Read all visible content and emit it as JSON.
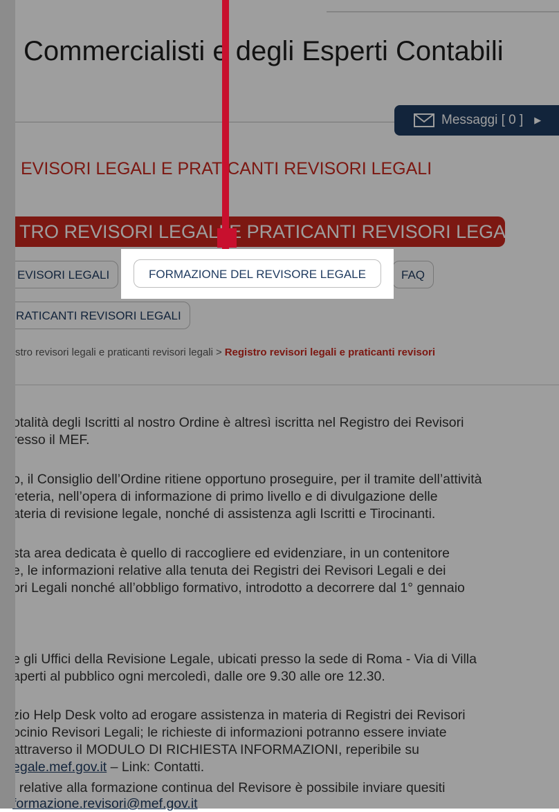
{
  "header": {
    "title": "Commercialisti e degli Esperti Contabili"
  },
  "messages_button": {
    "label": "Messaggi [ 0 ]",
    "icon": "mail-icon"
  },
  "section": {
    "title": "EVISORI LEGALI E PRATICANTI REVISORI LEGALI",
    "active_nav": "TRO REVISORI LEGALI E PRATICANTI REVISORI LEGALI"
  },
  "tabs": {
    "revisori": "EVISORI LEGALI",
    "formazione": "FORMAZIONE DEL REVISORE LEGALE",
    "faq": "FAQ",
    "praticanti": "RATICANTI REVISORI LEGALI"
  },
  "breadcrumb": {
    "parent": "stro revisori legali e praticanti revisori legali",
    "separator": ">",
    "current": "Registro revisori legali e praticanti revisori"
  },
  "content": {
    "p1_l1": "otalità degli Iscritti al nostro Ordine è altresì iscritta nel Registro dei Revisori",
    "p1_l2": "resso il MEF.",
    "p2_l1": "o, il Consiglio dell’Ordine ritiene opportuno proseguire, per il tramite dell’attività",
    "p2_l2": "reteria, nell’opera di informazione di primo livello e di divulgazione delle",
    "p2_l3": "ateria di revisione legale, nonché di assistenza agli Iscritti e Tirocinanti.",
    "p3_l1": "sta area dedicata è quello di raccogliere ed evidenziare, in un contenitore",
    "p3_l2": "e, le informazioni relative alla tenuta dei Registri dei Revisori Legali e dei",
    "p3_l3": "ori Legali nonché all’obbligo formativo, introdotto a decorrere dal 1° gennaio",
    "p4_l1": "e gli Uffici della Revisione Legale, ubicati presso la sede di Roma - Via di Villa",
    "p4_l2": "aperti al pubblico ogni mercoledì, dalle ore 9.30 alle ore 12.30.",
    "p5_l1": "zio Help Desk volto ad erogare assistenza in materia di Registri dei Revisori",
    "p5_l2": "ocinio Revisori Legali; le richieste di informazioni potranno essere inviate",
    "p5_l3": "attraverso il MODULO DI RICHIESTA INFORMAZIONI, reperibile su",
    "p5_l4_link": "egale.mef.gov.it",
    "p5_l4_rest": " – Link: Contatti.",
    "p6_l1": "i relative alla formazione continua del Revisore è possibile inviare quesiti",
    "p6_l2_link": "formazione.revisori@mef.gov.it"
  },
  "colors": {
    "brand_red": "#c8281e",
    "navy": "#1e3a5f",
    "pointer_red": "#c8102e"
  }
}
